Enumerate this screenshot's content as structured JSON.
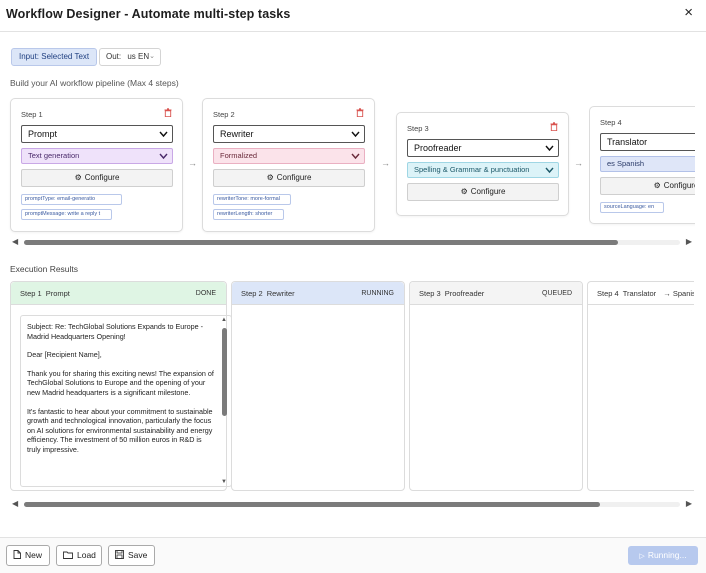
{
  "window": {
    "title": "Workflow Designer - Automate multi-step tasks",
    "close_icon": "×"
  },
  "toolbar": {
    "input_label": "Input: Selected Text",
    "out_label": "Out:",
    "out_flag": "us",
    "out_value": "EN"
  },
  "pipeline": {
    "label": "Build your AI workflow pipeline (Max 4 steps)",
    "steps": [
      {
        "label": "Step 1",
        "type": "Prompt",
        "option": "Text generation",
        "configure": "Configure",
        "tags": [
          "promptType: email-generatio",
          "promptMessage: write a reply t"
        ]
      },
      {
        "label": "Step 2",
        "type": "Rewriter",
        "option": "Formalized",
        "configure": "Configure",
        "tags": [
          "rewriterTone: more-formal",
          "rewriterLength: shorter"
        ]
      },
      {
        "label": "Step 3",
        "type": "Proofreader",
        "option": "Spelling & Grammar & punctuation",
        "configure": "Configure",
        "tags": []
      },
      {
        "label": "Step 4",
        "type": "Translator",
        "option": "es Spanish",
        "configure": "Configure",
        "tags": [
          "sourceLanguage: en"
        ]
      }
    ],
    "arrow": "→"
  },
  "results": {
    "label": "Execution Results",
    "columns": [
      {
        "step": "Step 1",
        "name": "Prompt",
        "status": "DONE"
      },
      {
        "step": "Step 2",
        "name": "Rewriter",
        "status": "RUNNING"
      },
      {
        "step": "Step 3",
        "name": "Proofreader",
        "status": "QUEUED"
      },
      {
        "step": "Step 4",
        "name": "Translator",
        "extra": "→ Spanish"
      }
    ],
    "output_paragraphs": [
      "Subject: Re: TechGlobal Solutions Expands to Europe - Madrid Headquarters Opening!",
      "Dear [Recipient Name],",
      "Thank you for sharing this exciting news! The expansion of TechGlobal Solutions to Europe and the opening of your new Madrid headquarters is a significant milestone.",
      "It's fantastic to hear about your commitment to sustainable growth and technological innovation, particularly the focus on AI solutions for environmental sustainability and energy efficiency. The investment of 50 million euros in R&D is truly impressive."
    ]
  },
  "bottom": {
    "new": "New",
    "load": "Load",
    "save": "Save",
    "run": "Running..."
  },
  "colors": {
    "accent": "#b7c9ee",
    "done": "#dff5e4",
    "running": "#dce6f8"
  }
}
